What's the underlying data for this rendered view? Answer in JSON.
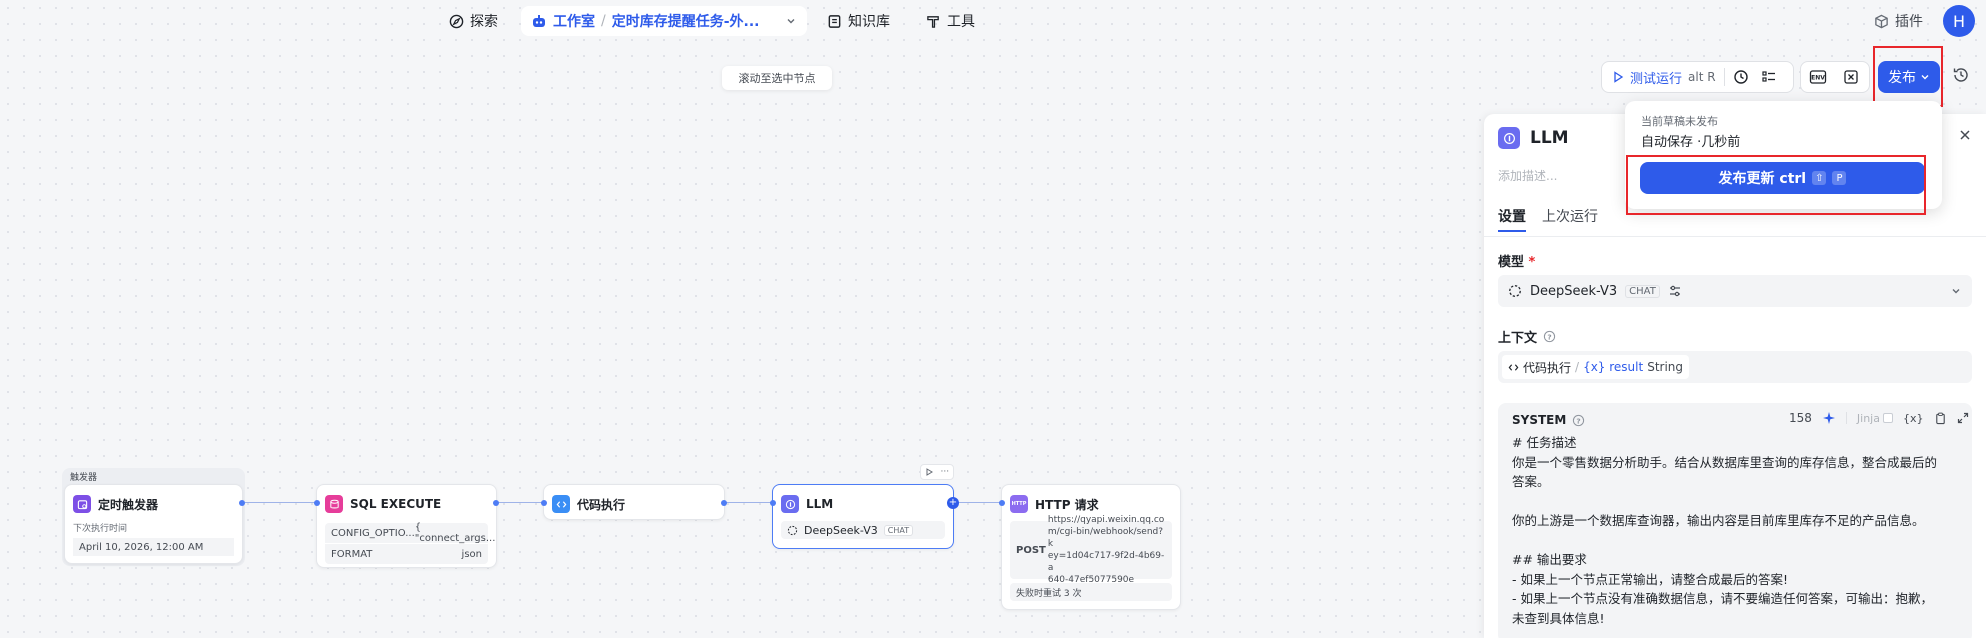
{
  "topnav": {
    "explore": "探索",
    "studio": "工作室",
    "workflow_name": "定时库存提醒任务-外...",
    "knowledge": "知识库",
    "tools": "工具",
    "plugins": "插件",
    "avatar_initial": "H"
  },
  "toolbar": {
    "test_run": "测试运行",
    "test_run_shortcut": "alt R",
    "publish": "发布"
  },
  "canvas": {
    "scroll_hint": "滚动至选中节点",
    "trigger": {
      "group_label": "触发器",
      "title": "定时触发器",
      "field_label": "下次执行时间",
      "next_run": "April 10, 2026, 12:00 AM"
    },
    "sql": {
      "title": "SQL EXECUTE",
      "row1_key": "CONFIG_OPTIO...",
      "row1_val": "{ \"connect_args...",
      "row2_key": "FORMAT",
      "row2_val": "json"
    },
    "code": {
      "title": "代码执行"
    },
    "llm": {
      "title": "LLM",
      "model": "DeepSeek-V3",
      "badge": "CHAT"
    },
    "http": {
      "title": "HTTP 请求",
      "method": "POST",
      "url_lines": [
        "https://qyapi.weixin.qq.co",
        "m/cgi-bin/webhook/send?k",
        "ey=1d04c717-9f2d-4b69-a",
        "640-47ef5077590e"
      ],
      "retry": "失败时重试 3 次"
    }
  },
  "popover": {
    "status": "当前草稿未发布",
    "autosave": "自动保存 ·几秒前",
    "publish_update": "发布更新 ctrl",
    "key_shift": "⇧",
    "key_p": "P"
  },
  "panel": {
    "title": "LLM",
    "desc_placeholder": "添加描述...",
    "tab_settings": "设置",
    "tab_last_run": "上次运行",
    "model_label": "模型",
    "required_mark": "*",
    "model_name": "DeepSeek-V3",
    "model_badge": "CHAT",
    "context_label": "上下文",
    "ctx_node": "代码执行",
    "ctx_sep": "/",
    "ctx_var": "{x} result",
    "ctx_type": "String",
    "system_label": "SYSTEM",
    "token_count": "158",
    "jinja": "Jinja",
    "vars_icon": "{x}",
    "prompt_lines": [
      "# 任务描述",
      "你是一个零售数据分析助手。结合从数据库里查询的库存信息，整合成最后的",
      "答案。",
      "",
      "你的上游是一个数据库查询器，输出内容是目前库里库存不足的产品信息。",
      "",
      "## 输出要求",
      "- 如果上一个节点正常输出，请整合成最后的答案!",
      "- 如果上一个节点没有准确数据信息，请不要编造任何答案，可输出：抱歉，",
      "未查到具体信息!"
    ]
  },
  "colors": {
    "accent": "#2e5bea",
    "highlight_box": "#e8262b",
    "trigger_icon": "#7d4fe6",
    "sql_icon": "#e63d9a",
    "code_icon": "#3a8ef5",
    "llm_icon": "#6a6cf0",
    "http_icon": "#8c6cf0"
  }
}
